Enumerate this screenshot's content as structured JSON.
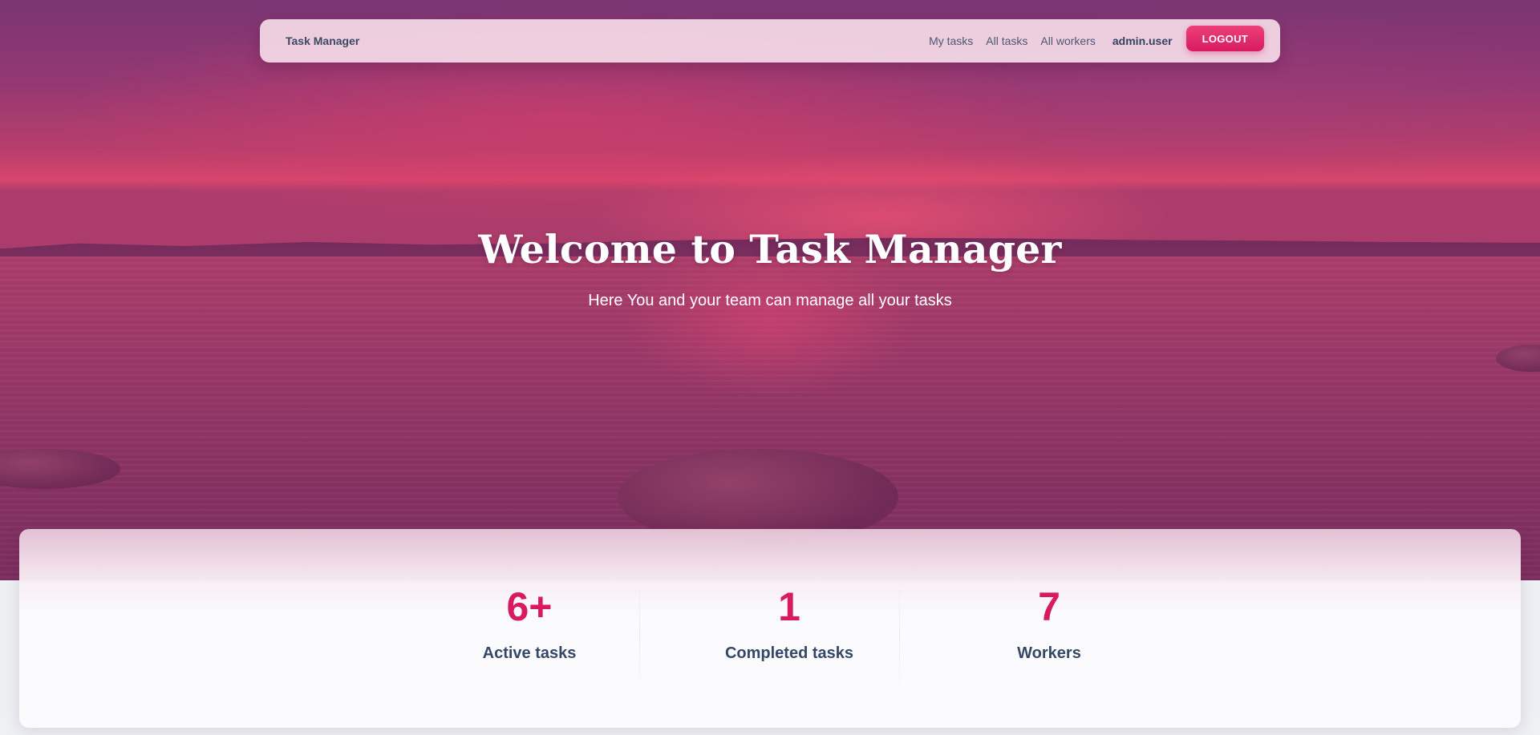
{
  "navbar": {
    "brand": "Task Manager",
    "links": [
      {
        "label": "My tasks"
      },
      {
        "label": "All tasks"
      },
      {
        "label": "All workers"
      }
    ],
    "username": "admin.user",
    "logout_label": "LOGOUT"
  },
  "hero": {
    "title": "Welcome to Task Manager",
    "subtitle": "Here You and your team can manage all your tasks"
  },
  "stats": [
    {
      "value": "6+",
      "label": "Active tasks"
    },
    {
      "value": "1",
      "label": "Completed tasks"
    },
    {
      "value": "7",
      "label": "Workers"
    }
  ],
  "colors": {
    "accent": "#d81b60",
    "text_dark": "#344767"
  }
}
